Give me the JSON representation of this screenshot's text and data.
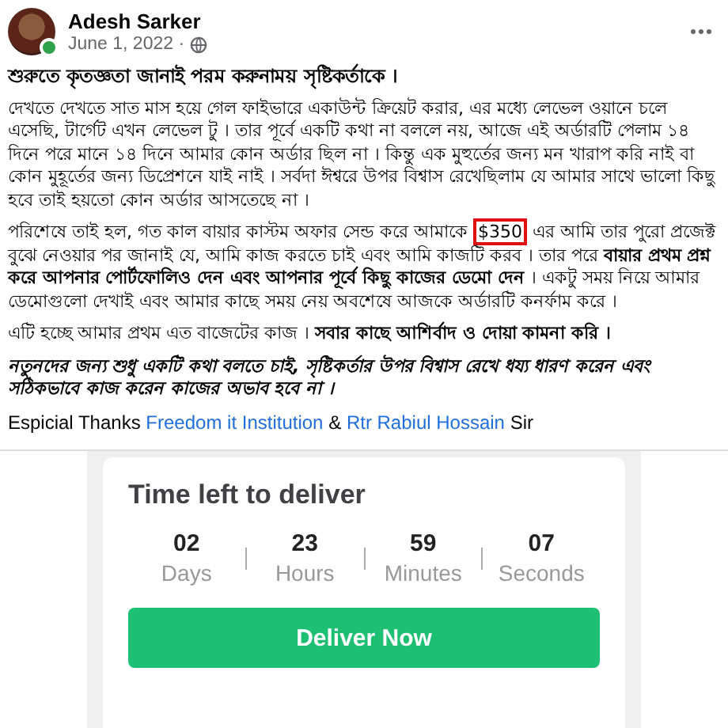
{
  "post": {
    "author": "Adesh Sarker",
    "date": "June 1, 2022 ·",
    "online": true,
    "heading": "শুরুতে কৃতজ্ঞতা জানাই পরম করুনাময় সৃষ্টিকর্তাকে ।",
    "paragraph_1": "দেখতে দেখতে সাত মাস হয়ে গেল ফাইভারে একাউন্ট ক্রিয়েট করার, এর মধ্যে লেভেল ওয়ানে চলে এসেছি, টার্গেট এখন লেভেল টু । তার পূর্বে একটি কথা না বললে নয়, আজে এই অর্ডারটি পেলাম ১৪ দিনে পরে মানে ১৪ দিনে আমার কোন অর্ডার ছিল না । কিন্তু এক মুহুর্তের জন্য মন খারাপ করি নাই বা কোন মুহূর্তের জন্য ডিপ্রেশনে যাই নাই । সর্বদা ঈশ্বরে উপর বিশ্বাস রেখেছিলাম যে আমার সাথে ভালো কিছু হবে তাই হয়তো কোন অর্ডার আসতেছে না ।",
    "paragraph_2": {
      "before": "পরিশেষে তাই হল, গত কাল বায়ার কাস্টম অফার সেন্ড করে আমাকে",
      "highlight": "$350",
      "after": "এর আমি তার পুরো প্রজেক্ট বুঝে নেওয়ার পর জানাই যে, আমি কাজ করতে চাই এবং আমি কাজটি করব । তার পরে **বায়ার প্রথম প্রশ্ন করে আপনার পোর্টফোলিও দেন এবং আপনার পূর্বে কিছু কাজের ডেমো দেন** । একটু সময় নিয়ে আমার ডেমোগুলো দেখাই এবং আমার কাছে সময় নেয় অবশেষে আজকে অর্ডারটি কনর্ফাম করে ।"
    },
    "paragraph_3": "এটি হচ্ছে আমার প্রথম এত বাজেটের কাজ । **সবার কাছে আশির্বাদ ও দোয়া কামনা করি ।**",
    "paragraph_4": "নতুনদের জন্য শুধু একটি কথা বলতে চাই, সৃষ্টিকর্তার উপর বিশ্বাস রেখে ধয্য ধারণ করেন এবং সঠিকভাবে কাজ করেন কাজের অভাব হবে না ।",
    "thanks": [
      {
        "kind": "text",
        "text": "Espicial Thanks"
      },
      {
        "kind": "link",
        "text": "Freedom it Institution"
      },
      {
        "kind": "text",
        "text": "&"
      },
      {
        "kind": "link",
        "text": "Rtr Rabiul Hossain"
      },
      {
        "kind": "text",
        "text": "Sir"
      }
    ]
  },
  "screenshot": {
    "title": "Time left to deliver",
    "countdown": [
      {
        "value": "02",
        "unit": "Days"
      },
      {
        "value": "23",
        "unit": "Hours"
      },
      {
        "value": "59",
        "unit": "Minutes"
      },
      {
        "value": "07",
        "unit": "Seconds"
      }
    ],
    "button": "Deliver Now"
  }
}
